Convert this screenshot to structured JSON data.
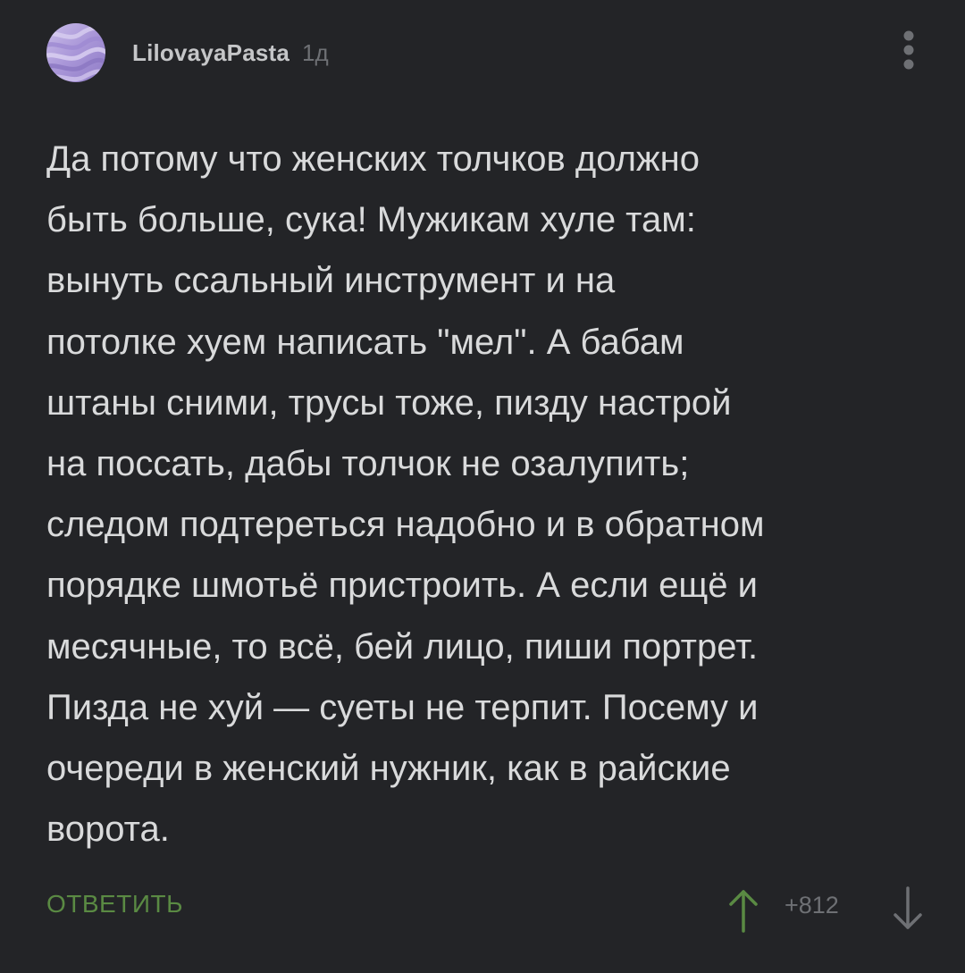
{
  "comment": {
    "author": "LilovayaPasta",
    "time": "1д",
    "text": "Да потому что женских толчков должно\nбыть больше, сука! Мужикам хуле там:\nвынуть ссальный инструмент и на\nпотолке хуем написать \"мел\". А бабам\nштаны сними, трусы тоже, пизду настрой\nна поссать, дабы толчок не озалупить;\nследом подтереться надобно и в обратном\nпорядке шмотьё пристроить. А если ещё и\nмесячные, то всё, бей лицо, пиши портрет.\nПизда не хуй — суеты не терпит. Посему и\nочереди в женский нужник, как в райские\nворота.",
    "reply_label": "ОТВЕТИТЬ",
    "score": "+812"
  },
  "icons": {
    "avatar": "lilac-paint-avatar",
    "menu": "more-vertical-icon",
    "upvote": "arrow-up-icon",
    "downvote": "arrow-down-icon"
  },
  "colors": {
    "background": "#232427",
    "text": "#d9dadb",
    "muted": "#6e7074",
    "accent_green": "#5a8a43",
    "upvote": "#5a8a43",
    "avatar": "#b3a3db"
  }
}
